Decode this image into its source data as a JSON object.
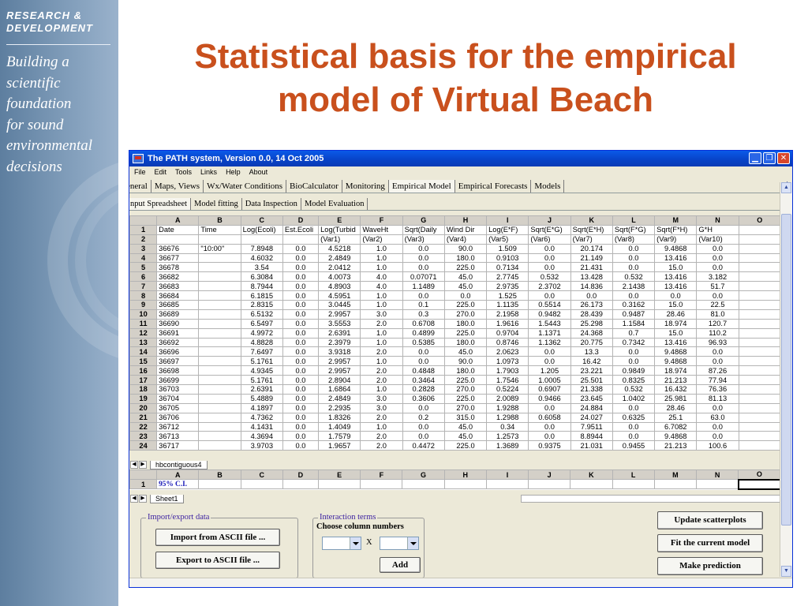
{
  "slide": {
    "sidebar_header": "RESEARCH & DEVELOPMENT",
    "sidebar_tagline": [
      "Building a",
      "scientific",
      "foundation",
      "for sound",
      "environmental",
      "decisions"
    ],
    "title_line1": "Statistical basis for the empirical",
    "title_line2": "model of Virtual Beach"
  },
  "app": {
    "window_title": "The PATH system, Version 0.0, 14 Oct 2005",
    "menu": [
      "File",
      "Edit",
      "Tools",
      "Links",
      "Help",
      "About"
    ],
    "tabs": [
      "eneral",
      "Maps, Views",
      "Wx/Water Conditions",
      "BioCalculator",
      "Monitoring",
      "Empirical Model",
      "Empirical Forecasts",
      "Models"
    ],
    "active_tab": "Empirical Model",
    "subtabs": [
      "nput Spreadsheet",
      "Model fitting",
      "Data Inspection",
      "Model Evaluation"
    ],
    "active_subtab": "nput Spreadsheet",
    "columns": [
      "A",
      "B",
      "C",
      "D",
      "E",
      "F",
      "G",
      "H",
      "I",
      "J",
      "K",
      "L",
      "M",
      "N",
      "O"
    ],
    "rows": [
      [
        "1",
        "Date",
        "Time",
        "Log(Ecoli)",
        "Est.Ecoli",
        "Log(Turbid",
        "WaveHt",
        "Sqrt(Daily",
        "Wind Dir",
        "Log(E*F)",
        "Sqrt(E*G)",
        "Sqrt(E*H)",
        "Sqrt(F*G)",
        "Sqrt(F*H)",
        "G*H",
        ""
      ],
      [
        "2",
        "",
        "",
        "",
        "",
        "(Var1)",
        "(Var2)",
        "(Var3)",
        "(Var4)",
        "(Var5)",
        "(Var6)",
        "(Var7)",
        "(Var8)",
        "(Var9)",
        "(Var10)",
        ""
      ],
      [
        "3",
        "36676",
        "\"10:00\"",
        "7.8948",
        "0.0",
        "4.5218",
        "1.0",
        "0.0",
        "90.0",
        "1.509",
        "0.0",
        "20.174",
        "0.0",
        "9.4868",
        "0.0",
        ""
      ],
      [
        "4",
        "36677",
        "",
        "4.6032",
        "0.0",
        "2.4849",
        "1.0",
        "0.0",
        "180.0",
        "0.9103",
        "0.0",
        "21.149",
        "0.0",
        "13.416",
        "0.0",
        ""
      ],
      [
        "5",
        "36678",
        "",
        "3.54",
        "0.0",
        "2.0412",
        "1.0",
        "0.0",
        "225.0",
        "0.7134",
        "0.0",
        "21.431",
        "0.0",
        "15.0",
        "0.0",
        ""
      ],
      [
        "6",
        "36682",
        "",
        "6.3084",
        "0.0",
        "4.0073",
        "4.0",
        "0.07071",
        "45.0",
        "2.7745",
        "0.532",
        "13.428",
        "0.532",
        "13.416",
        "3.182",
        ""
      ],
      [
        "7",
        "36683",
        "",
        "8.7944",
        "0.0",
        "4.8903",
        "4.0",
        "1.1489",
        "45.0",
        "2.9735",
        "2.3702",
        "14.836",
        "2.1438",
        "13.416",
        "51.7",
        ""
      ],
      [
        "8",
        "36684",
        "",
        "6.1815",
        "0.0",
        "4.5951",
        "1.0",
        "0.0",
        "0.0",
        "1.525",
        "0.0",
        "0.0",
        "0.0",
        "0.0",
        "0.0",
        ""
      ],
      [
        "9",
        "36685",
        "",
        "2.8315",
        "0.0",
        "3.0445",
        "1.0",
        "0.1",
        "225.0",
        "1.1135",
        "0.5514",
        "26.173",
        "0.3162",
        "15.0",
        "22.5",
        ""
      ],
      [
        "10",
        "36689",
        "",
        "6.5132",
        "0.0",
        "2.9957",
        "3.0",
        "0.3",
        "270.0",
        "2.1958",
        "0.9482",
        "28.439",
        "0.9487",
        "28.46",
        "81.0",
        ""
      ],
      [
        "11",
        "36690",
        "",
        "6.5497",
        "0.0",
        "3.5553",
        "2.0",
        "0.6708",
        "180.0",
        "1.9616",
        "1.5443",
        "25.298",
        "1.1584",
        "18.974",
        "120.7",
        ""
      ],
      [
        "12",
        "36691",
        "",
        "4.9972",
        "0.0",
        "2.6391",
        "1.0",
        "0.4899",
        "225.0",
        "0.9704",
        "1.1371",
        "24.368",
        "0.7",
        "15.0",
        "110.2",
        ""
      ],
      [
        "13",
        "36692",
        "",
        "4.8828",
        "0.0",
        "2.3979",
        "1.0",
        "0.5385",
        "180.0",
        "0.8746",
        "1.1362",
        "20.775",
        "0.7342",
        "13.416",
        "96.93",
        ""
      ],
      [
        "14",
        "36696",
        "",
        "7.6497",
        "0.0",
        "3.9318",
        "2.0",
        "0.0",
        "45.0",
        "2.0623",
        "0.0",
        "13.3",
        "0.0",
        "9.4868",
        "0.0",
        ""
      ],
      [
        "15",
        "36697",
        "",
        "5.1761",
        "0.0",
        "2.9957",
        "1.0",
        "0.0",
        "90.0",
        "1.0973",
        "0.0",
        "16.42",
        "0.0",
        "9.4868",
        "0.0",
        ""
      ],
      [
        "16",
        "36698",
        "",
        "4.9345",
        "0.0",
        "2.9957",
        "2.0",
        "0.4848",
        "180.0",
        "1.7903",
        "1.205",
        "23.221",
        "0.9849",
        "18.974",
        "87.26",
        ""
      ],
      [
        "17",
        "36699",
        "",
        "5.1761",
        "0.0",
        "2.8904",
        "2.0",
        "0.3464",
        "225.0",
        "1.7546",
        "1.0005",
        "25.501",
        "0.8325",
        "21.213",
        "77.94",
        ""
      ],
      [
        "18",
        "36703",
        "",
        "2.6391",
        "0.0",
        "1.6864",
        "1.0",
        "0.2828",
        "270.0",
        "0.5224",
        "0.6907",
        "21.338",
        "0.532",
        "16.432",
        "76.36",
        ""
      ],
      [
        "19",
        "36704",
        "",
        "5.4889",
        "0.0",
        "2.4849",
        "3.0",
        "0.3606",
        "225.0",
        "2.0089",
        "0.9466",
        "23.645",
        "1.0402",
        "25.981",
        "81.13",
        ""
      ],
      [
        "20",
        "36705",
        "",
        "4.1897",
        "0.0",
        "2.2935",
        "3.0",
        "0.0",
        "270.0",
        "1.9288",
        "0.0",
        "24.884",
        "0.0",
        "28.46",
        "0.0",
        ""
      ],
      [
        "21",
        "36706",
        "",
        "4.7362",
        "0.0",
        "1.8326",
        "2.0",
        "0.2",
        "315.0",
        "1.2988",
        "0.6058",
        "24.027",
        "0.6325",
        "25.1",
        "63.0",
        ""
      ],
      [
        "22",
        "36712",
        "",
        "4.1431",
        "0.0",
        "1.4049",
        "1.0",
        "0.0",
        "45.0",
        "0.34",
        "0.0",
        "7.9511",
        "0.0",
        "6.7082",
        "0.0",
        ""
      ],
      [
        "23",
        "36713",
        "",
        "4.3694",
        "0.0",
        "1.7579",
        "2.0",
        "0.0",
        "45.0",
        "1.2573",
        "0.0",
        "8.8944",
        "0.0",
        "9.4868",
        "0.0",
        ""
      ],
      [
        "24",
        "36717",
        "",
        "3.9703",
        "0.0",
        "1.9657",
        "2.0",
        "0.4472",
        "225.0",
        "1.3689",
        "0.9375",
        "21.031",
        "0.9455",
        "21.213",
        "100.6",
        ""
      ]
    ],
    "sheet_tab_1": "hbcontiguous4",
    "ci_row": [
      "1",
      "95% C.I.",
      "",
      "",
      "",
      "",
      "",
      "",
      "",
      "",
      "",
      "",
      "",
      "",
      "",
      ""
    ],
    "sheet_tab_2": "Sheet1",
    "import_export": {
      "legend": "Import/export data",
      "import_button": "Import from ASCII file ...",
      "export_button": "Export to ASCII file ..."
    },
    "interaction": {
      "legend": "Interaction terms",
      "caption": "Choose column numbers",
      "x_label": "X",
      "add_button": "Add"
    },
    "actions": {
      "update_scatterplots": "Update scatterplots",
      "fit_model": "Fit the current model",
      "make_prediction": "Make prediction"
    }
  }
}
